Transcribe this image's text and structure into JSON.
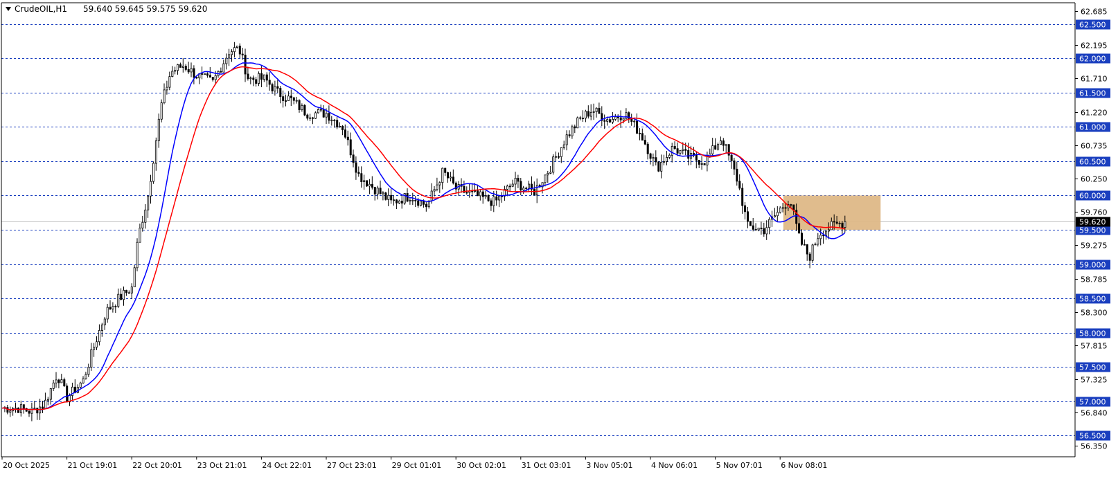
{
  "header": {
    "symbol_label": "CrudeOIL,H1",
    "ohlc_label": "59.640 59.645 59.575 59.620",
    "menu_icon": "triangle-down-icon"
  },
  "colors": {
    "background": "#ffffff",
    "frame": "#000000",
    "level_line": "#1a3fbf",
    "level_tag_bg": "#1a3fbf",
    "ma_fast": "#0000ff",
    "ma_slow": "#ff0000",
    "zone_fill": "#deb887",
    "current_price_line": "#c0c0c0",
    "current_price_tag": "#000000"
  },
  "chart_data": {
    "type": "candlestick",
    "symbol": "CrudeOIL",
    "timeframe": "H1",
    "ylim": [
      56.2,
      62.8
    ],
    "y_ticks": [
      56.35,
      56.84,
      57.325,
      57.815,
      58.3,
      58.785,
      59.275,
      59.76,
      60.25,
      60.735,
      61.22,
      61.71,
      62.195,
      62.685
    ],
    "y_tick_labels": [
      "56.350",
      "56.840",
      "57.325",
      "57.815",
      "58.300",
      "58.785",
      "59.275",
      "59.760",
      "60.250",
      "60.735",
      "61.220",
      "61.710",
      "62.195",
      "62.685"
    ],
    "x_labels": [
      "20 Oct 2025",
      "21 Oct 19:01",
      "22 Oct 20:01",
      "23 Oct 21:01",
      "24 Oct 22:01",
      "27 Oct 23:01",
      "29 Oct 01:01",
      "30 Oct 02:01",
      "31 Oct 03:01",
      "3 Nov 05:01",
      "4 Nov 06:01",
      "5 Nov 07:01",
      "6 Nov 08:01"
    ],
    "levels": [
      62.5,
      62.0,
      61.5,
      61.0,
      60.5,
      60.0,
      59.5,
      59.0,
      58.5,
      58.0,
      57.5,
      57.0,
      56.5
    ],
    "level_labels": [
      "62.500",
      "62.000",
      "61.500",
      "61.000",
      "60.500",
      "60.000",
      "59.500",
      "59.000",
      "58.500",
      "58.000",
      "57.500",
      "57.000",
      "56.500"
    ],
    "current_price": 59.62,
    "current_price_label": "59.620",
    "zone": {
      "low": 59.5,
      "high": 60.0,
      "from_day_index": 12.05,
      "to_day_index": 13.55
    },
    "sessions": 13,
    "anchor_closes": [
      [
        0,
        56.9
      ],
      [
        0.25,
        56.9
      ],
      [
        0.45,
        56.85
      ],
      [
        0.65,
        56.95
      ],
      [
        0.85,
        57.4
      ],
      [
        1.0,
        57.05
      ],
      [
        1.25,
        57.3
      ],
      [
        1.4,
        57.75
      ],
      [
        1.6,
        58.3
      ],
      [
        1.8,
        58.5
      ],
      [
        2.0,
        58.65
      ],
      [
        2.1,
        59.4
      ],
      [
        2.25,
        60.0
      ],
      [
        2.45,
        61.3
      ],
      [
        2.6,
        61.8
      ],
      [
        2.8,
        61.9
      ],
      [
        3.0,
        61.75
      ],
      [
        3.25,
        61.65
      ],
      [
        3.5,
        62.1
      ],
      [
        3.65,
        62.15
      ],
      [
        3.8,
        61.7
      ],
      [
        4.05,
        61.7
      ],
      [
        4.25,
        61.5
      ],
      [
        4.45,
        61.4
      ],
      [
        4.7,
        61.2
      ],
      [
        5.0,
        61.2
      ],
      [
        5.25,
        61.0
      ],
      [
        5.5,
        60.3
      ],
      [
        5.75,
        60.1
      ],
      [
        6.0,
        59.9
      ],
      [
        6.3,
        60.0
      ],
      [
        6.55,
        59.85
      ],
      [
        6.8,
        60.35
      ],
      [
        7.0,
        60.1
      ],
      [
        7.3,
        60.0
      ],
      [
        7.6,
        59.9
      ],
      [
        7.9,
        60.2
      ],
      [
        8.2,
        60.05
      ],
      [
        8.45,
        60.4
      ],
      [
        8.7,
        60.85
      ],
      [
        8.9,
        61.1
      ],
      [
        9.1,
        61.25
      ],
      [
        9.35,
        61.1
      ],
      [
        9.6,
        61.2
      ],
      [
        9.85,
        60.9
      ],
      [
        10.1,
        60.4
      ],
      [
        10.35,
        60.7
      ],
      [
        10.6,
        60.55
      ],
      [
        10.85,
        60.5
      ],
      [
        11.1,
        60.85
      ],
      [
        11.35,
        60.2
      ],
      [
        11.5,
        59.55
      ],
      [
        11.75,
        59.5
      ],
      [
        12.0,
        59.8
      ],
      [
        12.15,
        59.95
      ],
      [
        12.3,
        59.35
      ],
      [
        12.45,
        59.1
      ],
      [
        12.6,
        59.45
      ],
      [
        12.8,
        59.55
      ],
      [
        13.0,
        59.62
      ]
    ],
    "series": [
      {
        "name": "",
        "kind": "moving-average",
        "color": "blue",
        "period": 14
      },
      {
        "name": "",
        "kind": "moving-average",
        "color": "red",
        "period": 24
      }
    ],
    "grid": false
  }
}
